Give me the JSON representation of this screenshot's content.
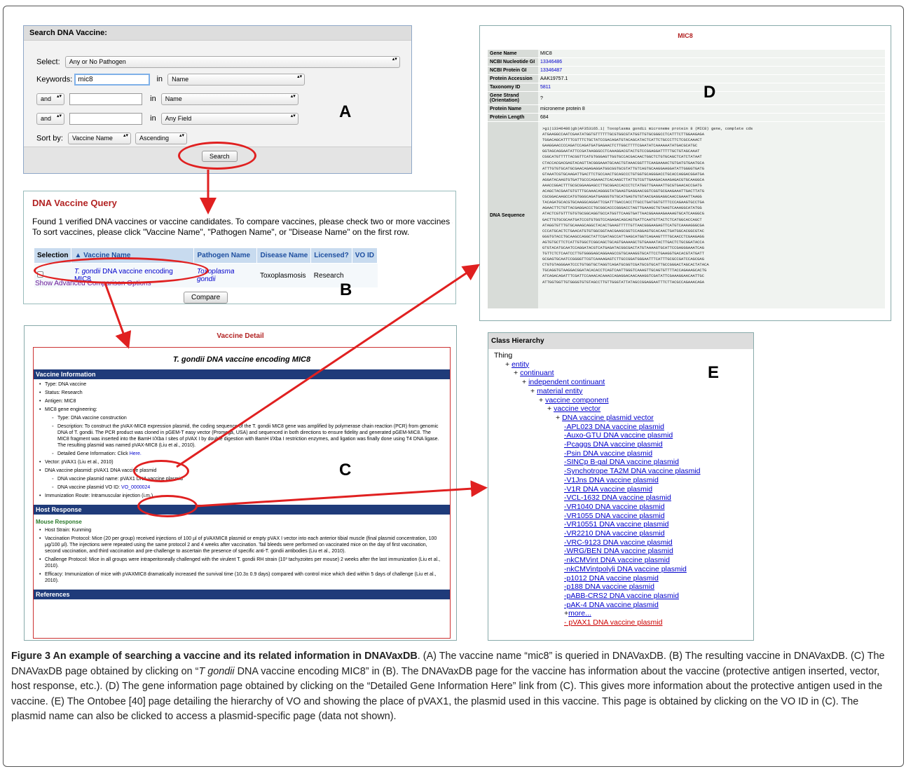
{
  "panel_a": {
    "header": "Search DNA Vaccine:",
    "select_label": "Select:",
    "select_value": "Any or No Pathogen",
    "keywords_label": "Keywords:",
    "keywords_value": "mic8",
    "in_label": "in",
    "field1": "Name",
    "op2": "and",
    "field2": "Name",
    "op3": "and",
    "field3": "Any Field",
    "sort_label": "Sort by:",
    "sort_field": "Vaccine Name",
    "sort_order": "Ascending",
    "search_button": "Search",
    "letter": "A"
  },
  "panel_b": {
    "title": "DNA Vaccine Query",
    "line1": "Found 1 verified DNA vaccines or vaccine candidates. To compare vaccines, please check two or more vaccines an",
    "line2": "To sort vaccines, please click \"Vaccine Name\", \"Pathogen Name\", or \"Disease Name\" on the first row.",
    "headers": [
      "Selection",
      "▲ Vaccine Name",
      "Pathogen Name",
      "Disease Name",
      "Licensed?",
      "VO ID"
    ],
    "row": {
      "vaccine_italic": "T. gondii",
      "vaccine_rest": " DNA vaccine encoding MIC8",
      "pathogen": "Toxoplasma gondii",
      "disease": "Toxoplasmosis",
      "licensed": "Research",
      "vo": ""
    },
    "advanced_link": "Show Advanced Comparison Options",
    "compare_button": "Compare",
    "letter": "B"
  },
  "panel_c": {
    "page_title": "Vaccine Detail",
    "name_italic": "T. gondii",
    "name_rest": " DNA vaccine encoding MIC8",
    "section1": "Vaccine Information",
    "type": "Type: DNA vaccine",
    "status": "Status: Research",
    "antigen": "Antigen: MIC8",
    "engineering": "MIC8 gene engineering:",
    "eng_type": "Type: DNA vaccine construction",
    "description": "Description: To construct the pVAX-MIC8 expression plasmid, the coding sequence of the T. gondii MIC8 gene was amplified by polymerase chain reaction (PCR) from genomic DNA of T. gondii. The PCR product was cloned in pGEM-T easy vector (Promega, USA) and sequenced in both directions to ensure fidelity and generated pGEM-MIC8. The MIC8 fragment was inserted into the BamH I/Xba I sites of pVAX I by double digestion with BamH I/Xba I restriction enzymes, and ligation was finally done using T4 DNA ligase. The resulting plasmid was named pVAX-MIC8 (Liu et al., 2010).",
    "detailed_label": "Detailed Gene Information:",
    "detailed_click": "Click ",
    "detailed_link": "Here.",
    "vector": "Vector: pVAX1 (Liu et al., 2010)",
    "plasmid": "DNA vaccine plasmid: pVAX1 DNA vaccine plasmid",
    "plasmid_name": "DNA vaccine plasmid name: pVAX1 DNA vaccine plasmid",
    "plasmid_vo_label": "DNA vaccine plasmid VO ID: ",
    "plasmid_vo": "VO_0000024",
    "route": "Immunization Route: Intramuscular injection (i.m.)",
    "section2": "Host Response",
    "mouse": "Mouse Response",
    "strain": "Host Strain: Kunming",
    "protocol": "Vaccination Protocol: Mice (20 per group) received injections of 100 µl of pVAXMIC8 plasmid or empty pVAX I vector into each anterior tibial muscle (final plasmid concentration, 100 µg/100 µl). The injections were repeated using the same protocol 2 and 4 weeks after vaccination. Tail bleeds were performed on vaccinated mice on the day of first vaccination, second vaccination, and third vaccination and pre-challenge to ascertain the presence of specific anti-T. gondii antibodies (Liu et al., 2010).",
    "challenge": "Challenge Protocol: Mice in all groups were intraperitoneally challenged with the virulent T. gondii RH strain (10³ tachyzoites per mouse) 2 weeks after the last immunization (Liu et al., 2010).",
    "efficacy": "Efficacy: Immunization of mice with pVAXMIC8 dramatically increased the survival time (10.3± 0.9 days) compared with control mice which died within 5 days of challenge (Liu et al., 2010).",
    "section3": "References",
    "letter": "C"
  },
  "panel_d": {
    "title": "MIC8",
    "rows": [
      {
        "k": "Gene Name",
        "v": "MIC8",
        "link": false
      },
      {
        "k": "NCBI Nucleotide GI",
        "v": "13346486",
        "link": true
      },
      {
        "k": "NCBI Protein GI",
        "v": "13346487",
        "link": true
      },
      {
        "k": "Protein Accession",
        "v": "AAK19757.1",
        "link": false
      },
      {
        "k": "Taxonomy ID",
        "v": "5811",
        "link": true
      },
      {
        "k": "Gene Strand (Orientation)",
        "v": "?",
        "link": false
      },
      {
        "k": "Protein Name",
        "v": "microneme protein 8",
        "link": false
      },
      {
        "k": "Protein Length",
        "v": "684",
        "link": false
      }
    ],
    "seq_label": "DNA Sequence",
    "seq_header": ">gi|13346486|gb|AF353165.1| Toxoplasma gondii microneme protein 8 (MIC8) gene, complete cds",
    "seq_lines": [
      "ATGAAGGCCAATCGAATATGGTGTTTTTTGCGTGGCGTATGGTTGTGCGGGCCTCATTTCTTGGAAGAGA",
      "TGGACAGCATTTTCGTTTCTGCTATCCGACAGATGTACAGCATACTCATTCTGCCCTTCTCGCCAAACT",
      "GAAGGAACCCCAGATCCAGATGATGAGAACTCTTGGCTTTTCGAATATCAAAAAATATGACGCATGC",
      "GGTAGCAGGAATATTCCGATAAGGGCCTCAAAGGACGTACTGTCCGGAGGATTTTTGCTGTAGCAAAT",
      "CGGCATGTTTTTACGGTTCATGTGGGAGTTGGTGCCACGACAACTGGCTCTGTGCAGCTCATCTATAAT",
      "CTACCACGACGAGTACAGTTACGGGAAATGCAACTGTAAACGGTTTCAAGAAAACTGTGATGTGAATGCA",
      "ATTTGTGTGCATGCGAACAGAGAGGATGGCGGTGCGTATTGTCAGTGCAAGGAAGGATATTGGGGTGATG",
      "GTAAATCGTGCAAGATTGACTTCTGCCAACTGCAGCCCTGTGGTGCAGGGACCTGCACCAGGACGGATGA",
      "AGGATACAAGTGTGATTGCCCAGAAACTCACAAGCTTATTGTCGTTGAAGACAAAGAGACGTGCAAGGCA",
      "AAACCGGACTTTGCGCGGAAGAGCCTTGCGGACCACCCTCTATGGTTGAAAATTGCGTGAACACCGATG",
      "ACAGCTACGAATGTGTTTGCAAACAGGGGTATGAAGTGAGGAACGGTCGGTGCGAAGAAATTGACTTATG",
      "CGCGGACAAGCCATGTGGGCAGATGAGGGTGTGCATGAGTGTGTAACGAGGAGGCAACCGAAATTAAGG",
      "TACAGATGCACGTGCAAGGCAGGATTCGATTTGACCACCTTGCCTGATGGTGTTTCCCAGAAGTGCCTGA",
      "AGAACTTCTGTTACGAGGACCCTGCGGCACCCGGGACCTAGTTGAAAGCTGTAAGTCAAAGGCATATGG",
      "ATACTCGTGTTTGTGTGCGGCAGGTGCCATGGTTCAAGTGATTAACGGAAAAGAAAAGTGCATCAAGGCG",
      "GACTTGTGCGCAATGATCCGTGTGGTCCAGAGACAGCAGTGATTCAATGTTACTCTCATGGCACCAGCT",
      "ATAGGTGTTTGTGCAAAGCAGGCTACACTGAAGTTTTTGTTAACGGGAAGAGTTCATGTCAAAAGGGCGA",
      "CCCATGCACTCTGAACATGTGTGGCGGTAACGAAGCGGTCCAGGAGTGCACAACTGATGGCACGGCGTAC",
      "GGGTGTACCTGCAAGCCAGGCTATTCGATAGCCATTAAGCATGGTCAGAAGTTTTGCAACCTCGAAGAGG",
      "AGTGTGCTTCTCATTGTGGCTCGGCAGCTGCAGTGAAAAGCTGTGAAAATACTTGACTCTGCGGATACCA",
      "GTGTACATGCAATCCAGGATACGTCATGAGATACGGCGACTATGTAAAAGTGCATTCCGAGGGAAATCAG",
      "TGTTCTCTCAATCCTTGTGGGGAGCAGGAAGCCGTGCAAAGGTGCATTCCTGAAGGTGACACGTATGATT",
      "GCGAGTGCAATCCGGGGTTCGTCAAAAGAGTCTTGCCGGATGGGAATTTCATTTGCGCCGATCCAGCGAG",
      "CTGTGTAGGGAATCCCTGTGGTGCTAGGTCAGATGCGGTCGATGCGTGCATTGCCGGGACTAGCACTATACA",
      "TGCAGGTGTAAGGACGGATACACACCTCAGTCAATTGGGTCAAAGTTGCAGTGTTTTACCAGAAAGCACTG",
      "ATCAGACAGATTTCGATTCCAAACACAAACCAGAGGACAACAAAGGTCGATATTCGAAAGGAACAATTGC",
      "ATTGGTGGTTGTGGGGTGTGTAGCCTTGTTGGGTATTATAGCCGGAGGAATTTCTTACGCCAGAAACAGA"
    ],
    "letter": "D"
  },
  "panel_e": {
    "header": "Class Hierarchy",
    "root": "Thing",
    "chain": [
      "entity",
      "continuant",
      "independent continuant",
      "material entity",
      "vaccine component",
      "vaccine vector",
      "DNA vaccine plasmid vector"
    ],
    "children": [
      "-APL023 DNA vaccine plasmid",
      "-Auxo-GTU DNA vaccine plasmid",
      "-Pcaggs DNA vaccine plasmid",
      "-Psin DNA vaccine plasmid",
      "-SINCp B-gal DNA vaccine plasmid",
      "-Synchotrope TA2M DNA vaccine plasmid",
      "-V1Jns DNA vaccine plasmid",
      "-V1R DNA vaccine plasmid",
      "-VCL-1632 DNA vaccine plasmid",
      "-VR1040 DNA vaccine plasmid",
      "-VR1055 DNA vaccine plasmid",
      "-VR10551 DNA vaccine plasmid",
      "-VR2210 DNA vaccine plasmid",
      "-VRC-9123 DNA vaccine plasmid",
      "-WRG/BEN DNA vaccine plasmid",
      "-nkCMVint DNA vaccine plasmid",
      "-nkCMVintpolyli DNA vaccine plasmid",
      "-p1012 DNA vaccine plasmid",
      "-p188 DNA vaccine plasmid",
      "-pABB-CRS2 DNA vaccine plasmid",
      "-pAK-4 DNA vaccine plasmid"
    ],
    "more": "more...",
    "selected": "- pVAX1 DNA vaccine plasmid",
    "letter": "E"
  },
  "caption": {
    "bold": "Figure 3 An example of searching a vaccine and its related information in DNAVaxDB",
    "part1": ". (A) The vaccine name “mic8” is queried in DNAVaxDB. (B) The resulting vaccine in DNAVaxDB. (C) The DNAVaxDB page obtained by clicking on “",
    "italic": "T gondii",
    "part2": " DNA vaccine encoding MIC8” in (B). The DNAVaxDB page for the vaccine has information about the vaccine (protective antigen inserted, vector, host response, etc.). (D) The gene information page obtained by clicking on the “Detailed Gene Information Here” link from (C). This gives more information about the protective antigen used in the vaccine. (E) The Ontobee [40] page detailing the hierarchy of VO and showing the place of pVAX1, the plasmid used in this vaccine. This page is obtained by clicking on the VO ID in (C). The plasmid name can also be clicked to access a plasmid-specific page (data not shown)."
  },
  "colors": {
    "arrow": "#e02020",
    "accent_blue": "#1f3b7a",
    "title_red": "#b22222"
  }
}
